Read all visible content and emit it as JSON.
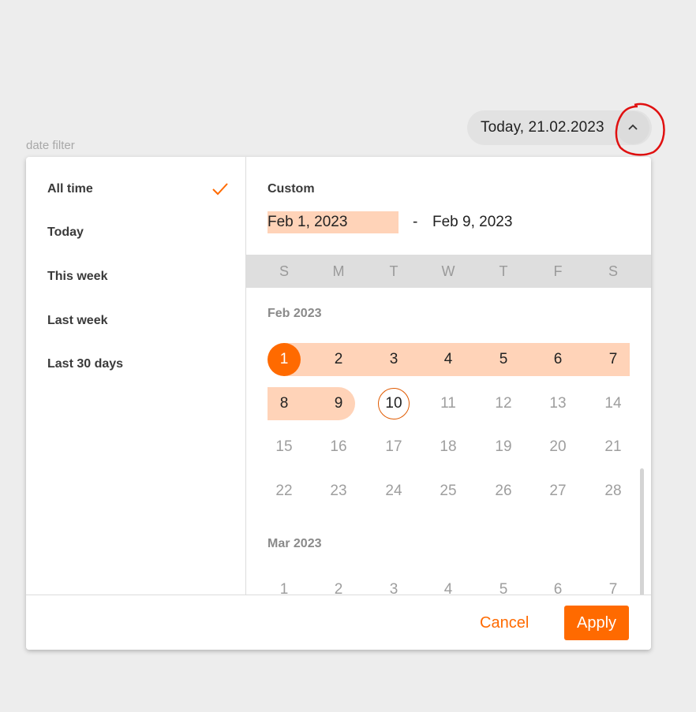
{
  "header": {
    "pill_text": "Today, 21.02.2023",
    "filter_label": "date filter"
  },
  "presets": [
    {
      "label": "All time",
      "selected": true
    },
    {
      "label": "Today",
      "selected": false
    },
    {
      "label": "This week",
      "selected": false
    },
    {
      "label": "Last week",
      "selected": false
    },
    {
      "label": "Last 30 days",
      "selected": false
    }
  ],
  "custom": {
    "title": "Custom",
    "start": "Feb 1, 2023",
    "separator": "-",
    "end": "Feb 9, 2023"
  },
  "weekdays": [
    "S",
    "M",
    "T",
    "W",
    "T",
    "F",
    "S"
  ],
  "months": [
    {
      "label": "Feb 2023",
      "weeks": [
        [
          "1",
          "2",
          "3",
          "4",
          "5",
          "6",
          "7"
        ],
        [
          "8",
          "9",
          "10",
          "11",
          "12",
          "13",
          "14"
        ],
        [
          "15",
          "16",
          "17",
          "18",
          "19",
          "20",
          "21"
        ],
        [
          "22",
          "23",
          "24",
          "25",
          "26",
          "27",
          "28"
        ]
      ]
    },
    {
      "label": "Mar 2023",
      "weeks": [
        [
          "1",
          "2",
          "3",
          "4",
          "5",
          "6",
          "7"
        ]
      ]
    }
  ],
  "range": {
    "start_day": "1",
    "end_day": "9",
    "today_day": "10"
  },
  "footer": {
    "cancel_label": "Cancel",
    "apply_label": "Apply"
  },
  "colors": {
    "accent": "#ff6a00",
    "range_fill": "#ffd3b8",
    "muted": "#9e9e9e"
  },
  "icons": {
    "toggle": "chevron-up-icon",
    "selected_preset": "check-icon"
  }
}
